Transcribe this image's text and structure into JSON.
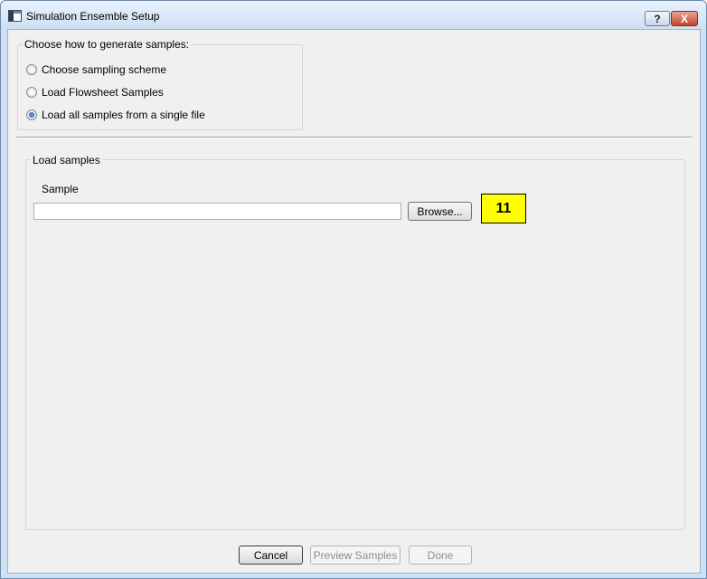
{
  "window": {
    "title": "Simulation Ensemble Setup",
    "help_label": "?",
    "close_label": "X"
  },
  "generate_group": {
    "label": "Choose how to generate samples:",
    "options": [
      {
        "label": "Choose sampling scheme",
        "selected": false
      },
      {
        "label": "Load Flowsheet Samples",
        "selected": false
      },
      {
        "label": "Load all samples from a single file",
        "selected": true
      }
    ]
  },
  "load_group": {
    "label": "Load samples",
    "sample_label": "Sample",
    "sample_value": "",
    "browse_label": "Browse...",
    "badge": "11"
  },
  "footer": {
    "cancel_label": "Cancel",
    "preview_label": "Preview Samples",
    "done_label": "Done"
  },
  "colors": {
    "badge_bg": "#ffff00",
    "frame": "#cfe0f3",
    "dialog_bg": "#f0f0f0"
  }
}
